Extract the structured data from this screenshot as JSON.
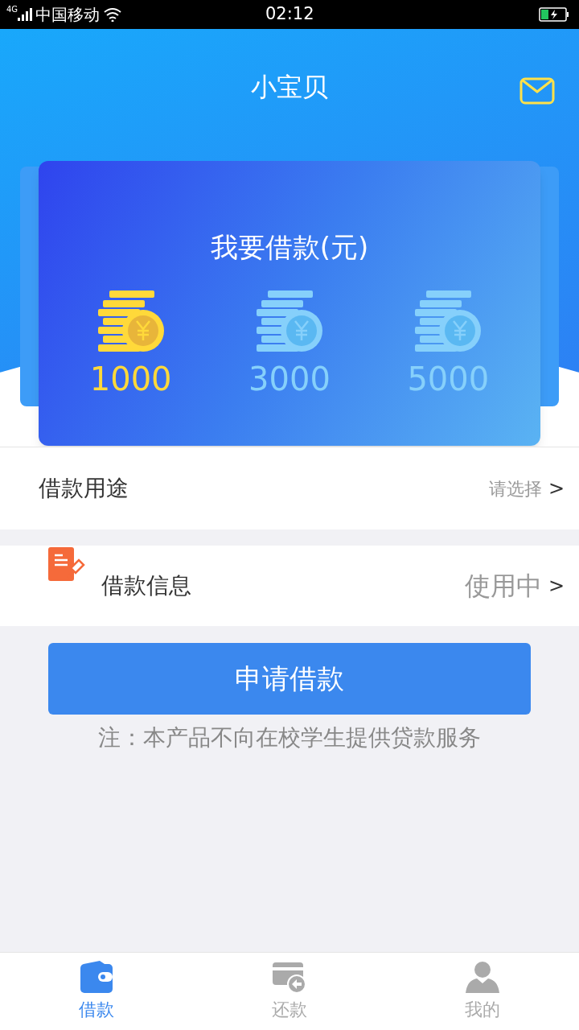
{
  "status_bar": {
    "network": "4G",
    "carrier": "中国移动",
    "time": "02:12"
  },
  "header": {
    "title": "小宝贝"
  },
  "card": {
    "title": "我要借款(元)",
    "amounts": [
      {
        "value": "1000",
        "selected": true
      },
      {
        "value": "3000",
        "selected": false
      },
      {
        "value": "5000",
        "selected": false
      }
    ]
  },
  "rows": [
    {
      "label": "借款用途",
      "value": "请选择",
      "chevron": ">",
      "kind": "plain"
    },
    {
      "label": "借款信息",
      "value": "使用中",
      "chevron": ">",
      "kind": "icon"
    }
  ],
  "apply_button": "申请借款",
  "note": "注：本产品不向在校学生提供贷款服务",
  "tabs": [
    {
      "label": "借款",
      "selected": true
    },
    {
      "label": "还款",
      "selected": false
    },
    {
      "label": "我的",
      "selected": false
    }
  ]
}
